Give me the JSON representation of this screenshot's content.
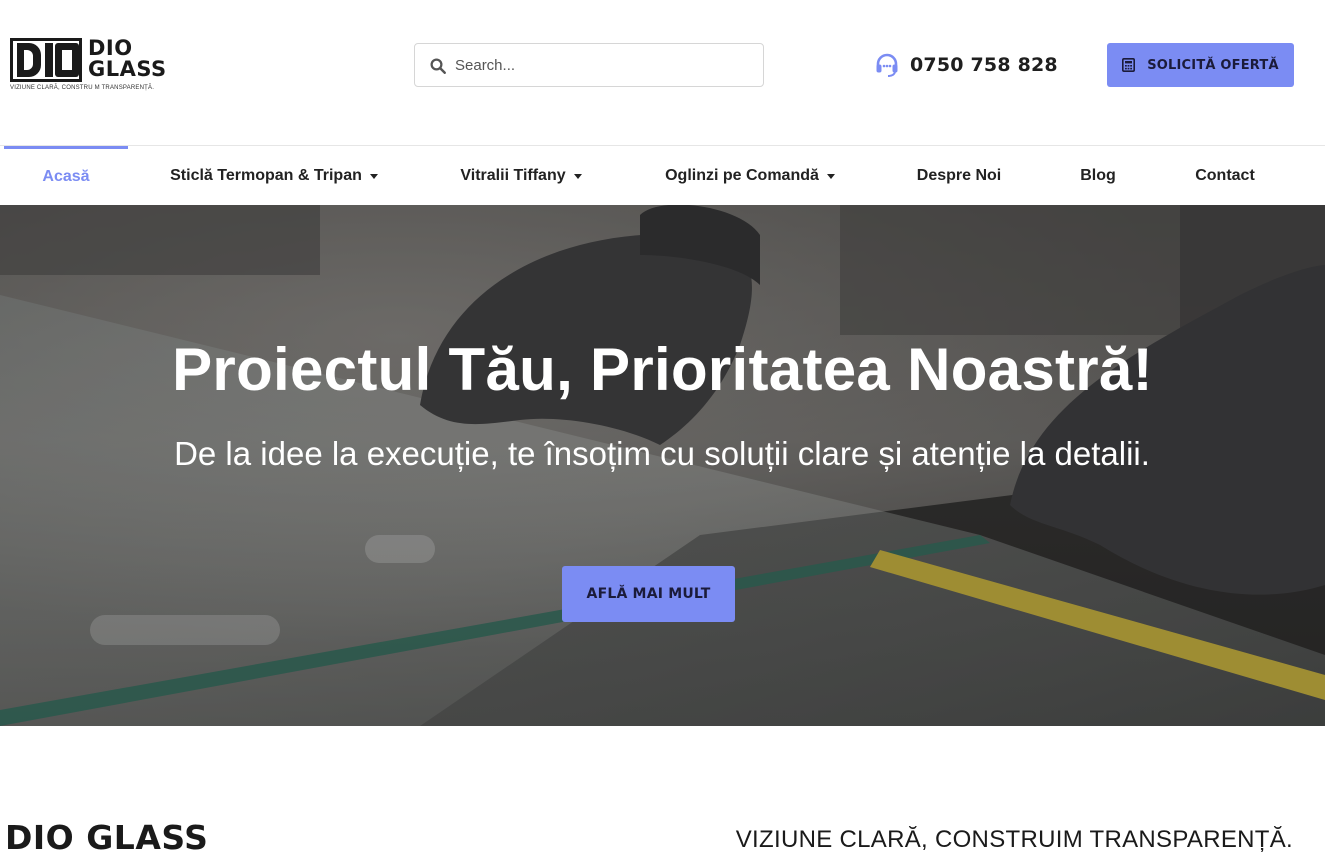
{
  "brand": {
    "name_line1": "DIO",
    "name_line2": "GLASS",
    "tagline_small": "VIZIUNE CLARĂ, CONSTRU M TRANSPARENȚĂ."
  },
  "search": {
    "placeholder": "Search..."
  },
  "contact": {
    "phone": "0750 758 828"
  },
  "header_cta": {
    "label": "SOLICITĂ OFERTĂ"
  },
  "nav": {
    "items": [
      {
        "label": "Acasă",
        "active": true,
        "dropdown": false
      },
      {
        "label": "Sticlă Termopan & Tripan",
        "active": false,
        "dropdown": true
      },
      {
        "label": "Vitralii Tiffany",
        "active": false,
        "dropdown": true
      },
      {
        "label": "Oglinzi pe Comandă",
        "active": false,
        "dropdown": true
      },
      {
        "label": "Despre Noi",
        "active": false,
        "dropdown": false
      },
      {
        "label": "Blog",
        "active": false,
        "dropdown": false
      },
      {
        "label": "Contact",
        "active": false,
        "dropdown": false
      }
    ]
  },
  "hero": {
    "title": "Proiectul Tău, Prioritatea Noastră!",
    "subtitle": "De la idee la execuție, te însoțim cu soluții clare și atenție la detalii.",
    "button_label": "AFLĂ MAI MULT"
  },
  "intro": {
    "brand": "DIO GLASS",
    "tagline": "VIZIUNE CLARĂ, CONSTRUIM TRANSPARENȚĂ."
  },
  "colors": {
    "accent": "#7b8cf3",
    "text_dark": "#1f1f1f",
    "hero_overlay": "#3a3a3a"
  },
  "icons": {
    "search": "search-icon",
    "phone": "headset-icon",
    "cta": "calculator-icon",
    "dropdown": "caret-down-icon"
  }
}
